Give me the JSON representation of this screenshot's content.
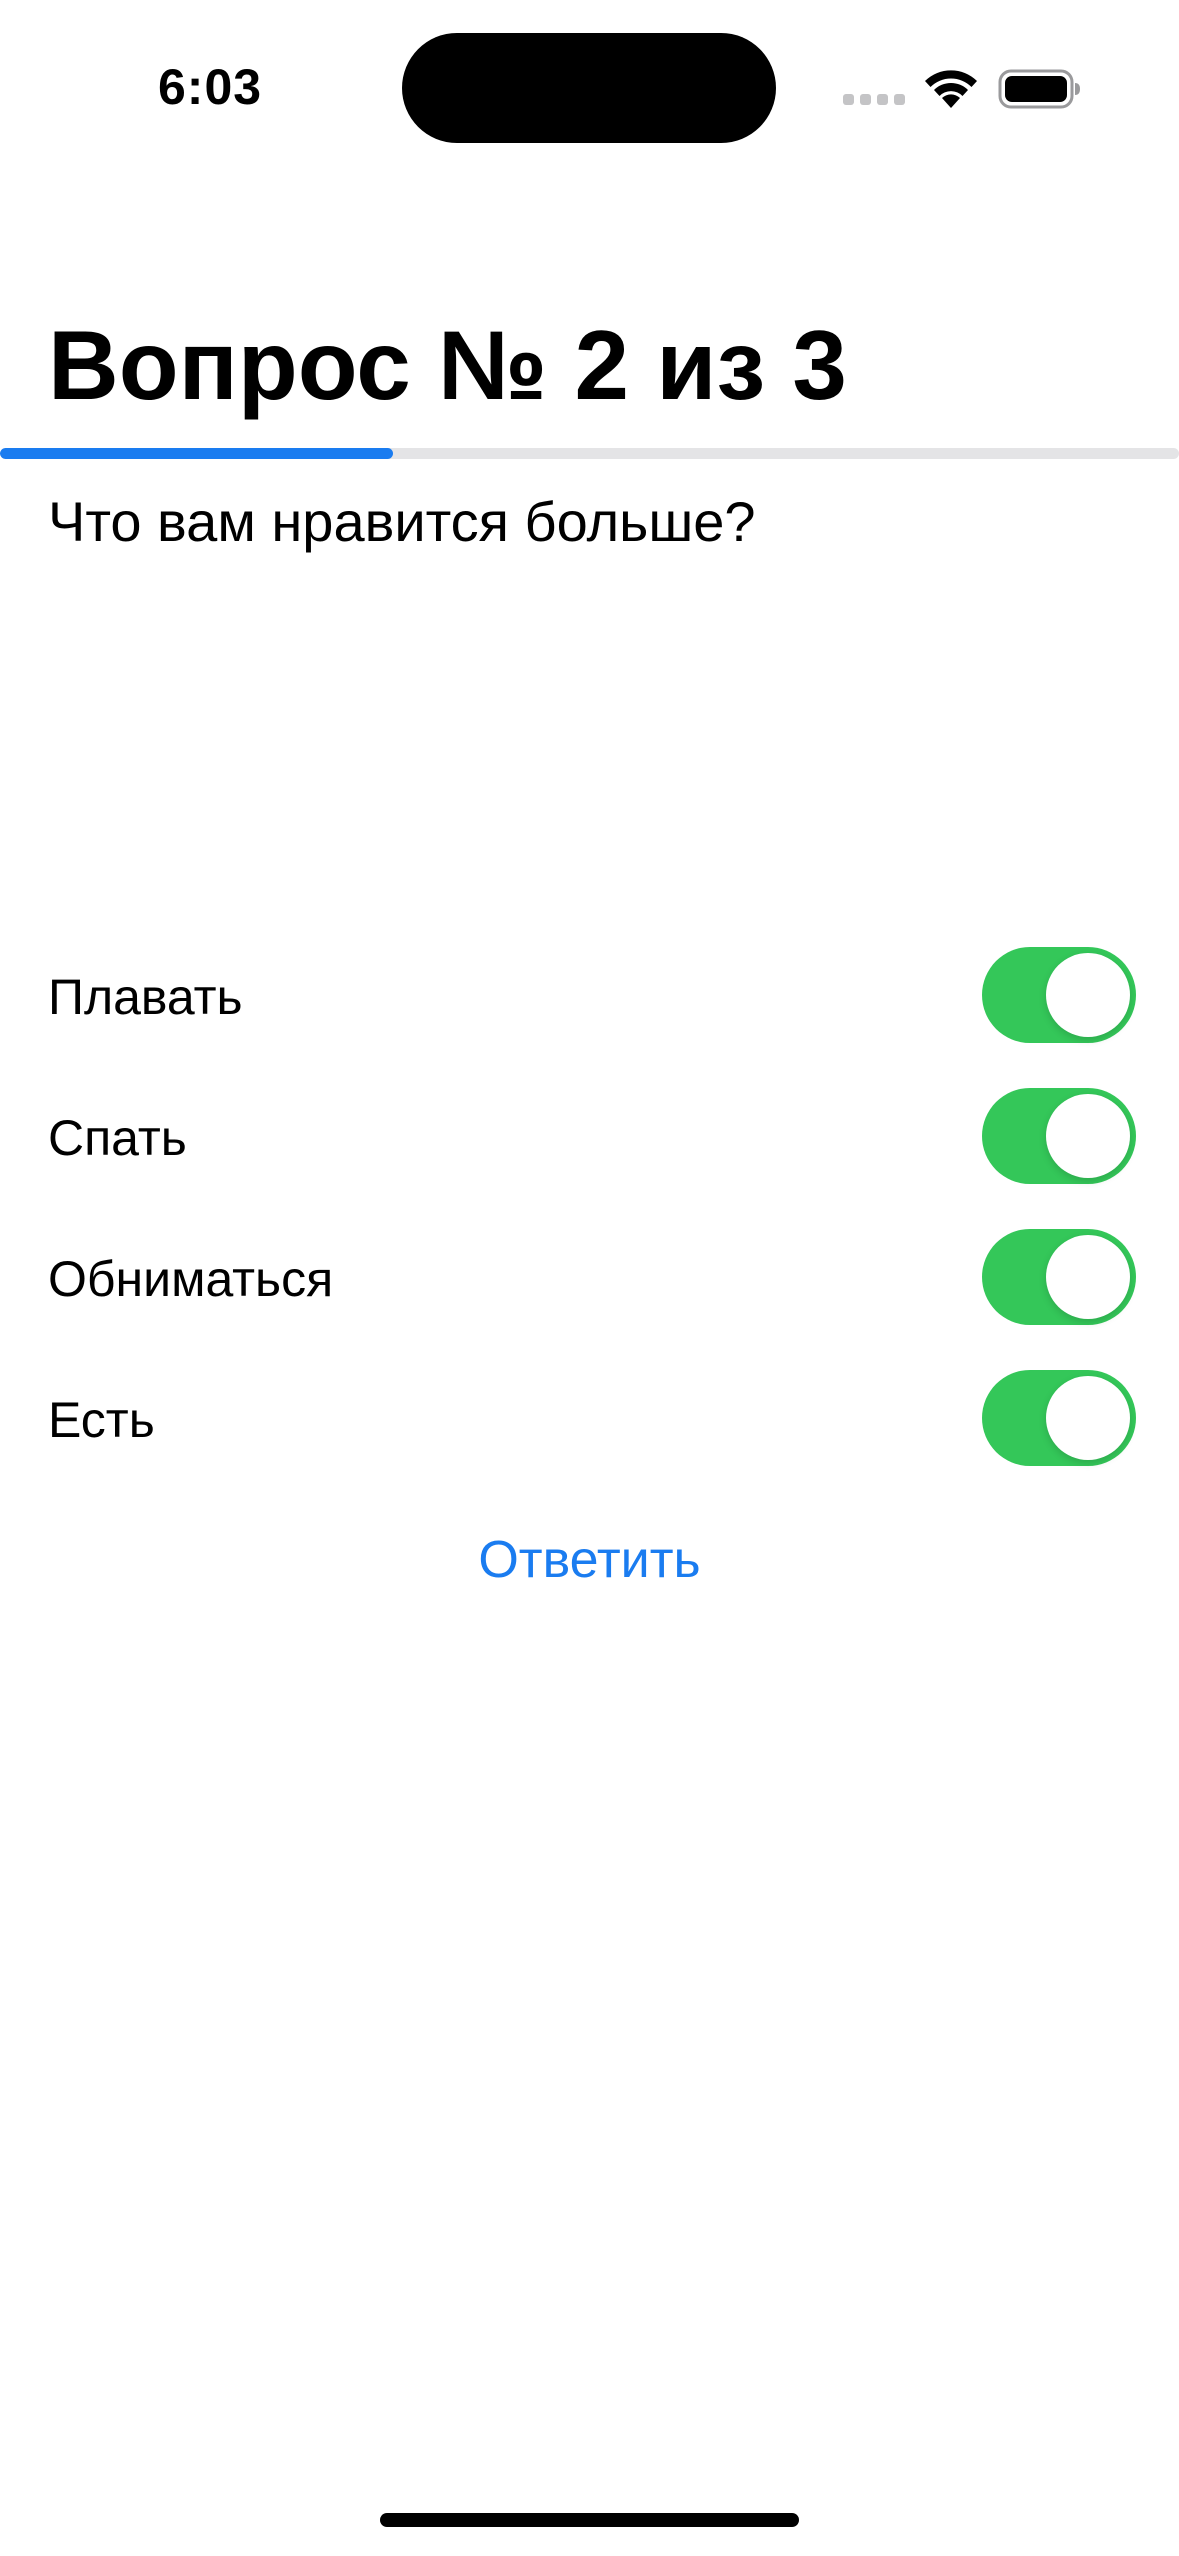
{
  "status_bar": {
    "time": "6:03"
  },
  "title": "Вопрос № 2 из 3",
  "progress": {
    "fraction": 0.333,
    "fill_color": "#1a7cf0",
    "track_color": "#e4e4e6"
  },
  "question": "Что вам нравится больше?",
  "answers": [
    {
      "label": "Плавать",
      "on": true
    },
    {
      "label": "Спать",
      "on": true
    },
    {
      "label": "Обниматься",
      "on": true
    },
    {
      "label": "Есть",
      "on": true
    }
  ],
  "answer_button": {
    "label": "Ответить"
  },
  "colors": {
    "toggle_on": "#34c759",
    "accent": "#1a7cf0"
  }
}
